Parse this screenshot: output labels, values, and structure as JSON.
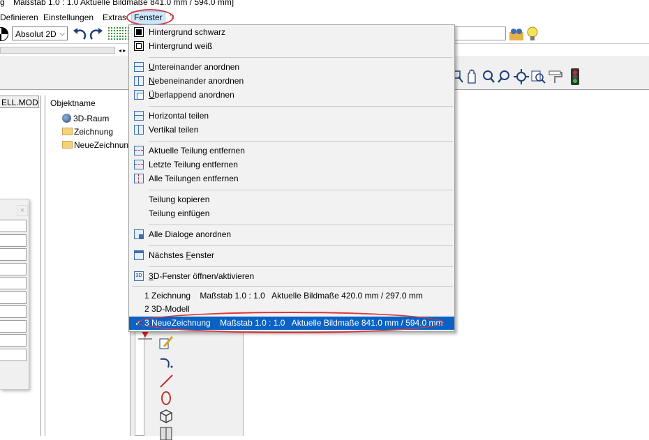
{
  "title_bar": {
    "prefix": "g",
    "text": "Maßstab 1.0 : 1.0   Aktuelle Bildmaße 841.0 mm / 594.0 mm]"
  },
  "menubar": {
    "items": [
      "Definieren",
      "Einstellungen",
      "Extras",
      "Fenster"
    ],
    "partial_char": "?"
  },
  "toolbar": {
    "combo_value": "Absolut 2D"
  },
  "left_tab": {
    "label": "ELL.MOD"
  },
  "tree": {
    "header": "Objektname",
    "items": [
      {
        "label": "3D-Raum",
        "icon": "globe-icon"
      },
      {
        "label": "Zeichnung",
        "icon": "folder-icon"
      },
      {
        "label": "NeueZeichnun",
        "icon": "folder-icon"
      }
    ]
  },
  "dialog": {
    "close_glyph": "×"
  },
  "fenster_menu": {
    "groups": [
      [
        {
          "label": "Hintergrund schwarz",
          "icon": "black-background-icon"
        },
        {
          "label": "Hintergrund weiß",
          "icon": "white-background-icon"
        }
      ],
      [
        {
          "label": "Untereinander anordnen",
          "ul": "U",
          "rest": "ntereinander anordnen",
          "icon": "tile-horizontal-icon"
        },
        {
          "label": "Nebeneinander anordnen",
          "ul": "N",
          "rest": "ebeneinander anordnen",
          "icon": "tile-vertical-icon"
        },
        {
          "label": "Überlappend anordnen",
          "ul": "Ü",
          "rest": "berlappend anordnen",
          "icon": "cascade-icon"
        }
      ],
      [
        {
          "label": "Horizontal teilen",
          "icon": "split-horizontal-icon"
        },
        {
          "label": "Vertikal teilen",
          "icon": "split-vertical-icon"
        }
      ],
      [
        {
          "label": "Aktuelle Teilung entfernen",
          "icon": "remove-split-icon"
        },
        {
          "label": "Letzte Teilung entfernen",
          "icon": "remove-last-split-icon"
        },
        {
          "label": "Alle Teilungen entfernen",
          "icon": "remove-all-splits-icon"
        }
      ],
      [
        {
          "label": "Teilung kopieren",
          "icon": ""
        },
        {
          "label": "Teilung einfügen",
          "icon": ""
        }
      ],
      [
        {
          "label": "Alle Dialoge anordnen",
          "icon": "arrange-dialogs-icon"
        }
      ],
      [
        {
          "label": "Nächstes Fenster",
          "pre": "Nächstes ",
          "ul": "F",
          "rest": "enster",
          "icon": "next-window-icon"
        }
      ],
      [
        {
          "label": "3D-Fenster öffnen/aktivieren",
          "ul": "3",
          "rest": "D-Fenster öffnen/aktivieren",
          "icon": "3d-window-icon"
        }
      ]
    ],
    "windows": [
      {
        "label": "1 Zeichnung    Maßstab 1.0 : 1.0   Aktuelle Bildmaße 420.0 mm / 297.0 mm",
        "checked": false
      },
      {
        "label": "2 3D-Modell",
        "checked": false
      },
      {
        "label": "3 NeueZeichnung    Maßstab 1.0 : 1.0   Aktuelle Bildmaße 841.0 mm / 594.0 mm",
        "checked": true
      }
    ],
    "check_glyph": "✓"
  },
  "colors": {
    "selection": "#0a63c4",
    "callout": "#d9363e",
    "menu_bg": "#f2f2f2",
    "active_menu": "#cce8ff"
  }
}
